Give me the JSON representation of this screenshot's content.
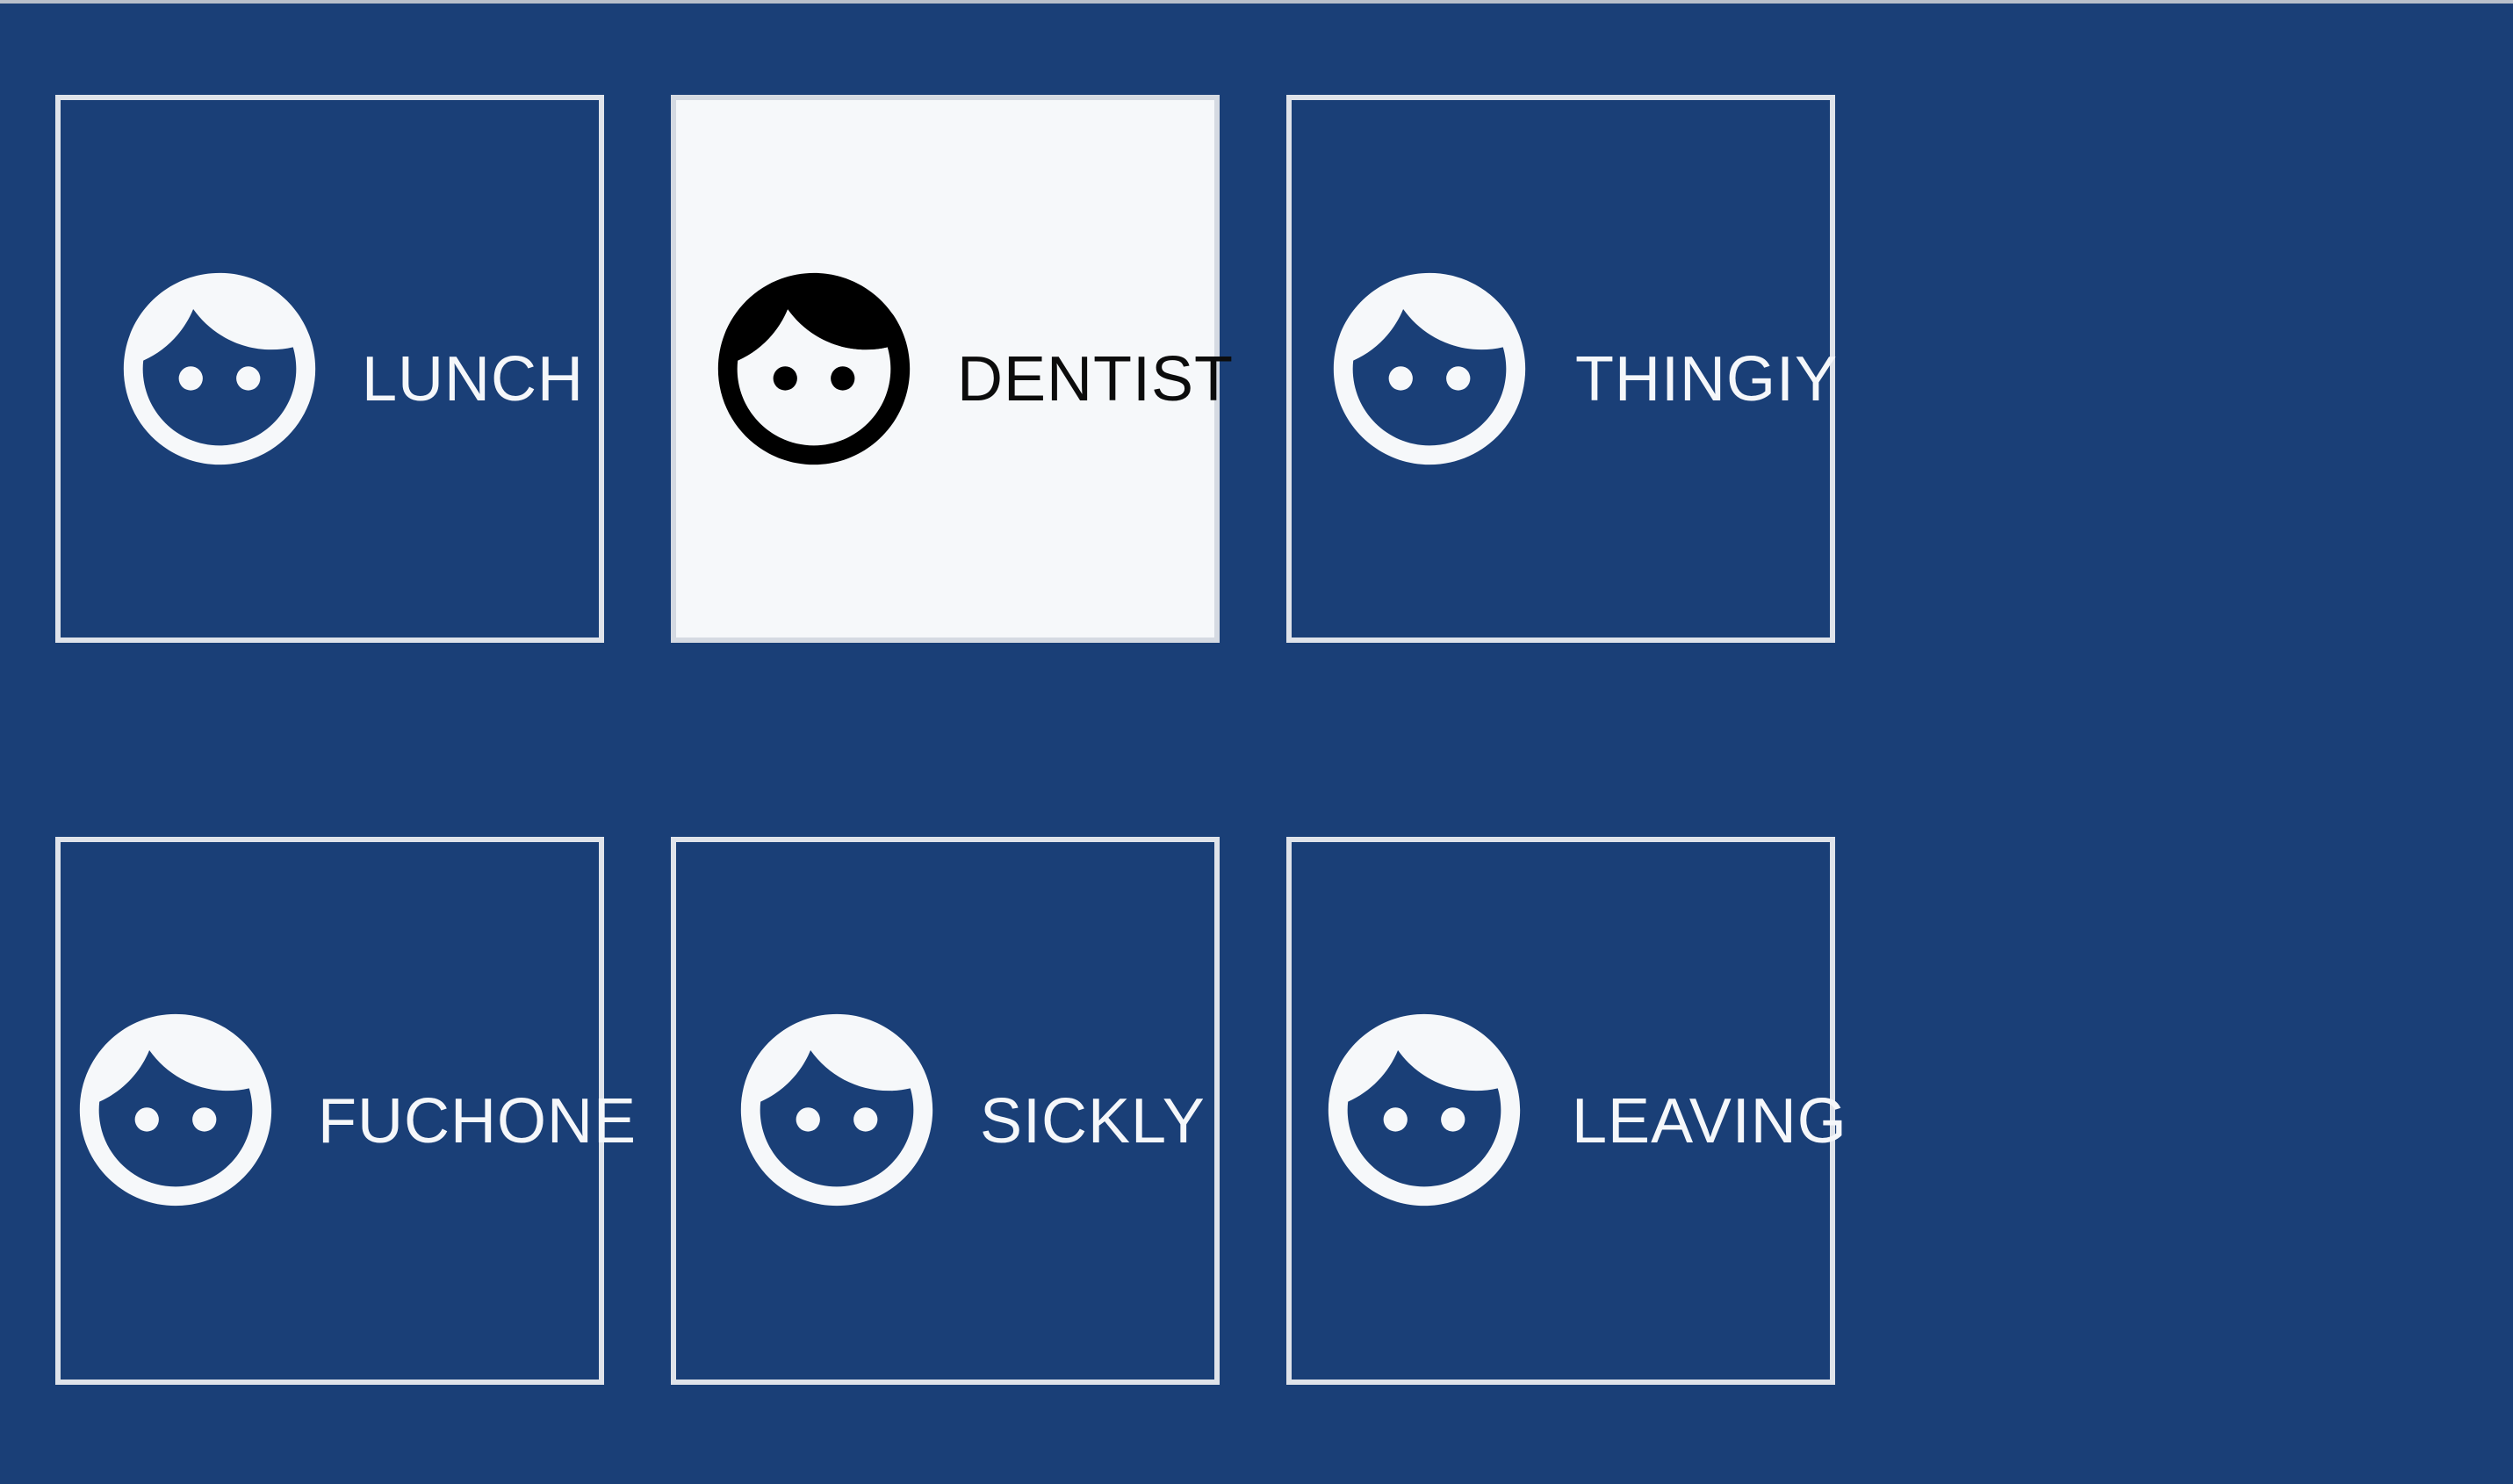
{
  "tiles": [
    {
      "label": "LUNCH",
      "selected": false,
      "icon": "face-icon"
    },
    {
      "label": "DENTIST",
      "selected": true,
      "icon": "face-icon"
    },
    {
      "label": "THINGIY",
      "selected": false,
      "icon": "face-icon"
    },
    {
      "label": "FUCHONE",
      "selected": false,
      "icon": "face-icon"
    },
    {
      "label": "SICKLY",
      "selected": false,
      "icon": "face-icon"
    },
    {
      "label": "LEAVING",
      "selected": false,
      "icon": "face-icon"
    }
  ],
  "colors": {
    "background": "#1a3f77",
    "tile_border": "#dfe3ea",
    "selected_fill": "#f6f8fa",
    "icon_light": "#f6f8fa",
    "icon_dark": "#000000"
  }
}
